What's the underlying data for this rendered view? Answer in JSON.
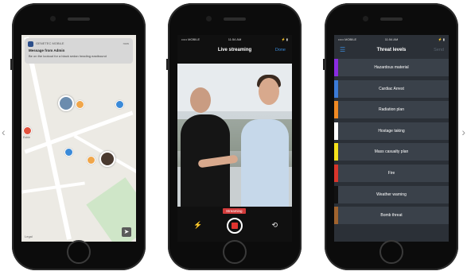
{
  "map_screen": {
    "notification": {
      "app": "GENETEC MOBILE",
      "time": "now",
      "title": "Message from Admin",
      "message": "Be on the lookout for a black sedan heading eastbound"
    },
    "legal": "Legal",
    "place_label": "Estrie"
  },
  "stream_screen": {
    "status": {
      "carrier": "••••• MOBILE",
      "time": "11:54 AM",
      "battery": "⚡ ▮"
    },
    "title": "Live streaming",
    "done_label": "Done",
    "streaming_badge": "Streaming"
  },
  "threat_screen": {
    "status": {
      "carrier": "••••• MOBILE",
      "time": "11:54 AM",
      "battery": "⚡ ▮"
    },
    "title": "Threat levels",
    "send_label": "Send",
    "items": [
      {
        "label": "Hazardous material",
        "color": "#8a2be2"
      },
      {
        "label": "Cardiac Arrest",
        "color": "#3b7bd8"
      },
      {
        "label": "Radiation plan",
        "color": "#f08a24"
      },
      {
        "label": "Hostage taking",
        "color": "#ffffff"
      },
      {
        "label": "Mass casualty plan",
        "color": "#f5e21c"
      },
      {
        "label": "Fire",
        "color": "#d9352b"
      },
      {
        "label": "Weather warning",
        "color": "#111111"
      },
      {
        "label": "Bomb threat",
        "color": "#a0632e"
      }
    ]
  }
}
